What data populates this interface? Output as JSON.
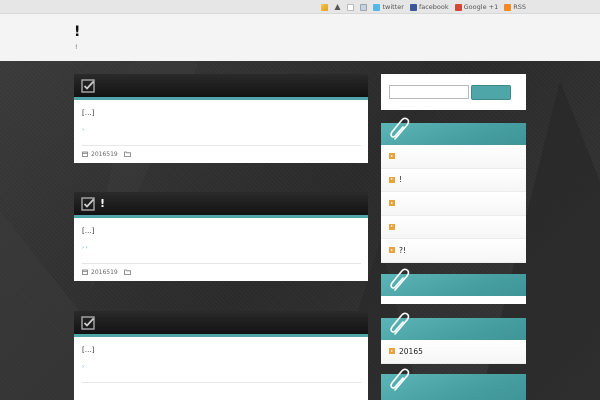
{
  "topbar": {
    "links": [
      {
        "icon": "feather-icon",
        "label": ""
      },
      {
        "icon": "tree-icon",
        "label": ""
      },
      {
        "icon": "page-icon",
        "label": ""
      },
      {
        "icon": "mail-icon",
        "label": ""
      },
      {
        "icon": "twitter-icon",
        "label": "twitter"
      },
      {
        "icon": "facebook-icon",
        "label": "facebook"
      },
      {
        "icon": "googleplus-icon",
        "label": "Google +1"
      },
      {
        "icon": "rss-icon",
        "label": "RSS"
      }
    ]
  },
  "header": {
    "title": "!",
    "description": "!"
  },
  "posts": [
    {
      "title": "",
      "excerpt": "[…]",
      "more": "›",
      "date": "2016519"
    },
    {
      "title": "!",
      "excerpt": "[…]",
      "more": "› ›",
      "date": "2016519"
    },
    {
      "title": "",
      "excerpt": "[…]",
      "more": "›",
      "date": ""
    }
  ],
  "sidebar": {
    "search": {
      "value": "",
      "button": ""
    },
    "widgets": [
      {
        "items": [
          "",
          "!",
          "",
          "",
          "?!"
        ]
      },
      {
        "items": []
      },
      {
        "items": [
          "20165"
        ]
      },
      {
        "items": []
      }
    ]
  },
  "colors": {
    "accent": "#4fa6a8",
    "bullet": "#e8a33d",
    "dark_bg": "#2f2f2f"
  }
}
